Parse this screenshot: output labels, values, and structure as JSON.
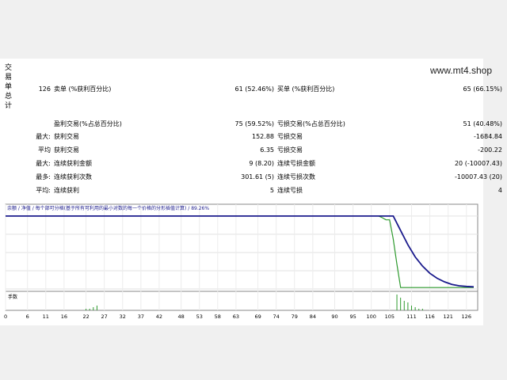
{
  "watermark": "www.mt4.shop",
  "side_tab": [
    "交",
    "易",
    "单",
    "总",
    "计"
  ],
  "stats": {
    "total": "126",
    "sell_label": "卖单 (%获利百分比)",
    "sell_value": "61 (52.46%)",
    "buy_label": "买单 (%获利百分比)",
    "buy_value": "65 (66.15%)",
    "profit_trades_label": "盈利交易(%占总百分比)",
    "profit_trades_value": "75 (59.52%)",
    "loss_trades_label": "亏损交易(%占总百分比)",
    "loss_trades_value": "51 (40.48%)",
    "rows": [
      {
        "prefix": "最大:",
        "l_label": "获利交易",
        "l_value": "152.88",
        "r_label": "亏损交易",
        "r_value": "-1684.84"
      },
      {
        "prefix": "平均",
        "l_label": "获利交易",
        "l_value": "6.35",
        "r_label": "亏损交易",
        "r_value": "-200.22"
      },
      {
        "prefix": "最大:",
        "l_label": "连续获利金额",
        "l_value": "9 (8.20)",
        "r_label": "连续亏损金额",
        "r_value": "20 (-10007.43)"
      },
      {
        "prefix": "最多:",
        "l_label": "连续获利次数",
        "l_value": "301.61 (5)",
        "r_label": "连续亏损次数",
        "r_value": "-10007.43 (20)"
      },
      {
        "prefix": "平均:",
        "l_label": "连续获利",
        "l_value": "5",
        "r_label": "连续亏损",
        "r_value": "4"
      }
    ]
  },
  "chart": {
    "legend_text": "余额 / 净值 / 每个部可分格(基于所有可利用的最小对数的每一个价格的分形插值计算) / 89.26%",
    "volume_label": "手数",
    "colors": {
      "balance": "#1a1a8c",
      "equity": "#2e9a2e",
      "volume": "#2e9a2e"
    }
  },
  "chart_data": {
    "type": "line",
    "x_ticks": [
      "0",
      "6",
      "11",
      "16",
      "22",
      "27",
      "32",
      "37",
      "42",
      "48",
      "53",
      "58",
      "63",
      "69",
      "74",
      "79",
      "84",
      "90",
      "95",
      "100",
      "105",
      "111",
      "116",
      "121",
      "126"
    ],
    "y_ticks": [
      "10234",
      "7675",
      "5117",
      "2558",
      "0"
    ],
    "xlim": [
      0,
      128
    ],
    "ylim": [
      0,
      11000
    ],
    "series": [
      {
        "values_x": [
          0,
          106,
          108,
          110,
          112,
          114,
          116,
          118,
          120,
          122,
          124,
          126,
          128
        ],
        "values_y": [
          10234,
          10234,
          8200,
          6200,
          4500,
          3200,
          2200,
          1500,
          1000,
          650,
          450,
          350,
          300
        ]
      },
      {
        "values_x": [
          0,
          102,
          103,
          104,
          105,
          106,
          107,
          108,
          128
        ],
        "values_y": [
          10234,
          10234,
          10000,
          9700,
          9700,
          7000,
          3500,
          200,
          200
        ]
      }
    ],
    "volume": {
      "x": [
        22,
        23,
        24,
        25,
        107,
        108,
        109,
        110,
        111,
        112,
        113,
        114
      ],
      "y": [
        1,
        1,
        2,
        3,
        10,
        8,
        6,
        5,
        3,
        2,
        1,
        1
      ]
    }
  }
}
